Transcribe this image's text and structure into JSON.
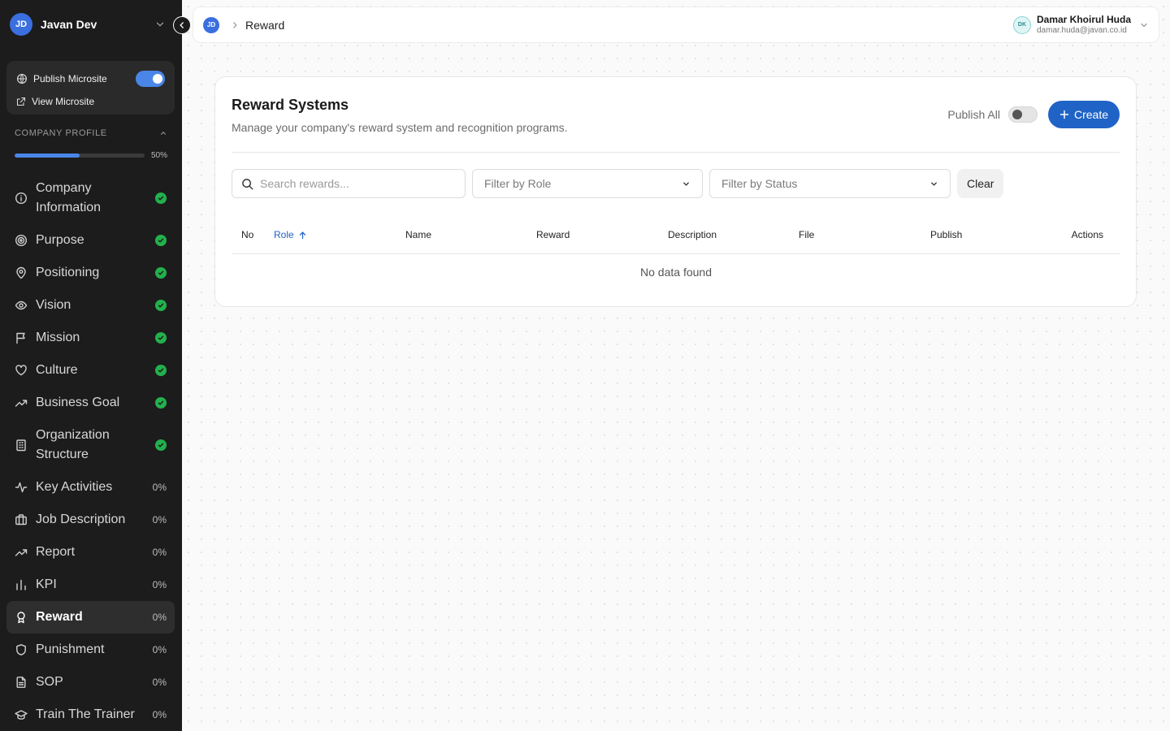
{
  "workspace": {
    "initials": "JD",
    "name": "Javan Dev"
  },
  "microsite": {
    "publish_label": "Publish Microsite",
    "publish_on": true,
    "view_label": "View Microsite"
  },
  "company_profile": {
    "heading": "COMPANY PROFILE",
    "progress_percent": 50,
    "progress_label": "50%"
  },
  "sidebar": {
    "items": [
      {
        "label": "Company Information",
        "icon": "info-icon",
        "status": "complete"
      },
      {
        "label": "Purpose",
        "icon": "target-icon",
        "status": "complete"
      },
      {
        "label": "Positioning",
        "icon": "map-pin-icon",
        "status": "complete"
      },
      {
        "label": "Vision",
        "icon": "eye-icon",
        "status": "complete"
      },
      {
        "label": "Mission",
        "icon": "flag-icon",
        "status": "complete"
      },
      {
        "label": "Culture",
        "icon": "heart-icon",
        "status": "complete"
      },
      {
        "label": "Business Goal",
        "icon": "trending-up-icon",
        "status": "complete"
      },
      {
        "label": "Organization Structure",
        "icon": "building-icon",
        "status": "complete"
      },
      {
        "label": "Key Activities",
        "icon": "activity-icon",
        "pct": "0%"
      },
      {
        "label": "Job Description",
        "icon": "briefcase-icon",
        "pct": "0%"
      },
      {
        "label": "Report",
        "icon": "trending-up-icon",
        "pct": "0%"
      },
      {
        "label": "KPI",
        "icon": "bar-chart-icon",
        "pct": "0%"
      },
      {
        "label": "Reward",
        "icon": "award-icon",
        "pct": "0%",
        "active": true
      },
      {
        "label": "Punishment",
        "icon": "shield-icon",
        "pct": "0%"
      },
      {
        "label": "SOP",
        "icon": "document-icon",
        "pct": "0%"
      },
      {
        "label": "Train The Trainer",
        "icon": "graduation-cap-icon",
        "pct": "0%"
      }
    ]
  },
  "topbar": {
    "breadcrumb": {
      "avatar": "JD",
      "current": "Reward"
    },
    "user": {
      "initials": "DK",
      "name": "Damar Khoirul Huda",
      "email": "damar.huda@javan.co.id"
    }
  },
  "main": {
    "title": "Reward Systems",
    "subtitle": "Manage your company's reward system and recognition programs.",
    "publish_all_label": "Publish All",
    "publish_all_on": false,
    "create_label": "Create",
    "search_placeholder": "Search rewards...",
    "filter_role": "Filter by Role",
    "filter_status": "Filter by Status",
    "clear_label": "Clear",
    "table": {
      "columns": [
        "No",
        "Role",
        "Name",
        "Reward",
        "Description",
        "File",
        "Publish",
        "Actions"
      ],
      "sorted_column": "Role",
      "empty_text": "No data found"
    }
  },
  "colors": {
    "accent": "#1f63c6",
    "sidebar_bg": "#1c1c1c",
    "success": "#22b14c",
    "toggle_on": "#4a86e8"
  }
}
